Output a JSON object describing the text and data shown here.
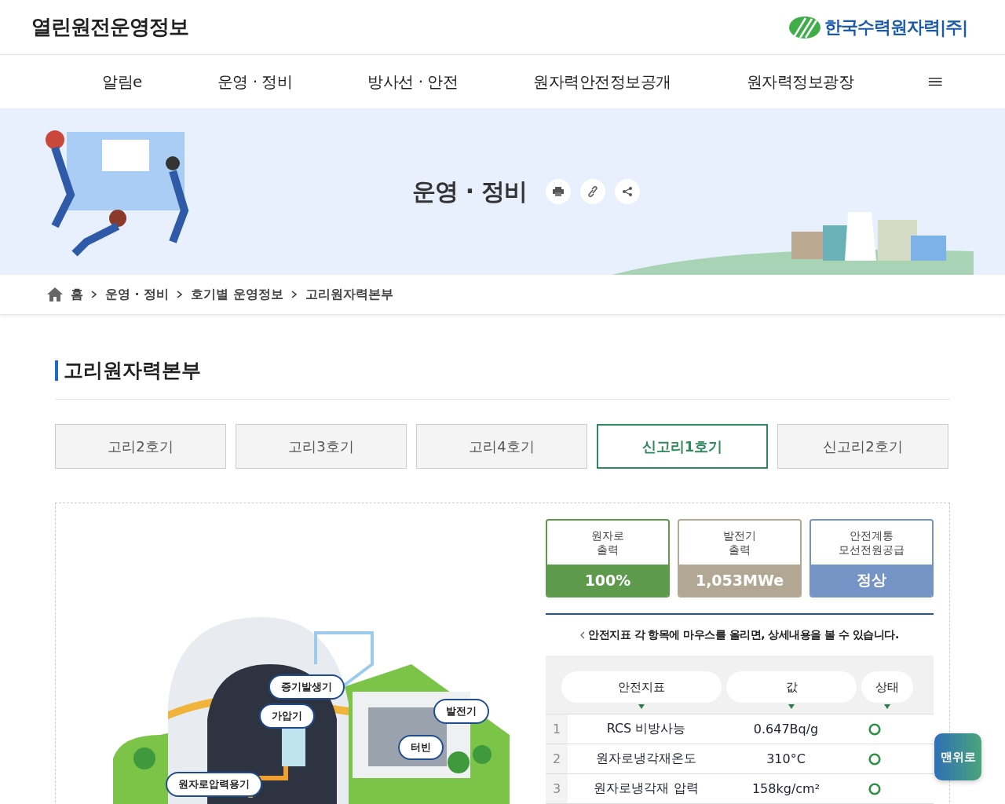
{
  "header": {
    "site_title": "열린원전운영정보",
    "logo_text": "한국수력원자력|주|"
  },
  "nav": {
    "items": [
      "알림e",
      "운영 · 정비",
      "방사선 · 안전",
      "원자력안전정보공개",
      "원자력정보광장"
    ]
  },
  "hero": {
    "title": "운영 · 정비"
  },
  "breadcrumb": [
    "홈",
    "운영 · 정비",
    "호기별 운영정보",
    "고리원자력본부"
  ],
  "section_title": "고리원자력본부",
  "unit_tabs": [
    {
      "label": "고리2호기",
      "selected": false
    },
    {
      "label": "고리3호기",
      "selected": false
    },
    {
      "label": "고리4호기",
      "selected": false
    },
    {
      "label": "신고리1호기",
      "selected": true
    },
    {
      "label": "신고리2호기",
      "selected": false
    }
  ],
  "plant_labels": [
    "증기발생기",
    "가압기",
    "발전기",
    "터빈",
    "원자로압력용기"
  ],
  "status_cards": [
    {
      "label": "원자로\n출력",
      "value": "100%",
      "color": "#5e9a4c"
    },
    {
      "label": "발전기\n출력",
      "value": "1,053MWe",
      "color": "#b2a792"
    },
    {
      "label": "안전계통\n모선전원공급",
      "value": "정상",
      "color": "#7594c6"
    }
  ],
  "hint": "안전지표 각 항목에 마우스를 올리면, 상세내용을 볼 수 있습니다.",
  "table": {
    "columns": [
      "안전지표",
      "값",
      "상태"
    ],
    "rows": [
      {
        "no": "1",
        "name": "RCS 비방사능",
        "value": "0.647Bq/g"
      },
      {
        "no": "2",
        "name": "원자로냉각재온도",
        "value": "310°C"
      },
      {
        "no": "3",
        "name": "원자로냉각재 압력",
        "value": "158kg/cm²"
      }
    ]
  },
  "top_button": "맨위로"
}
